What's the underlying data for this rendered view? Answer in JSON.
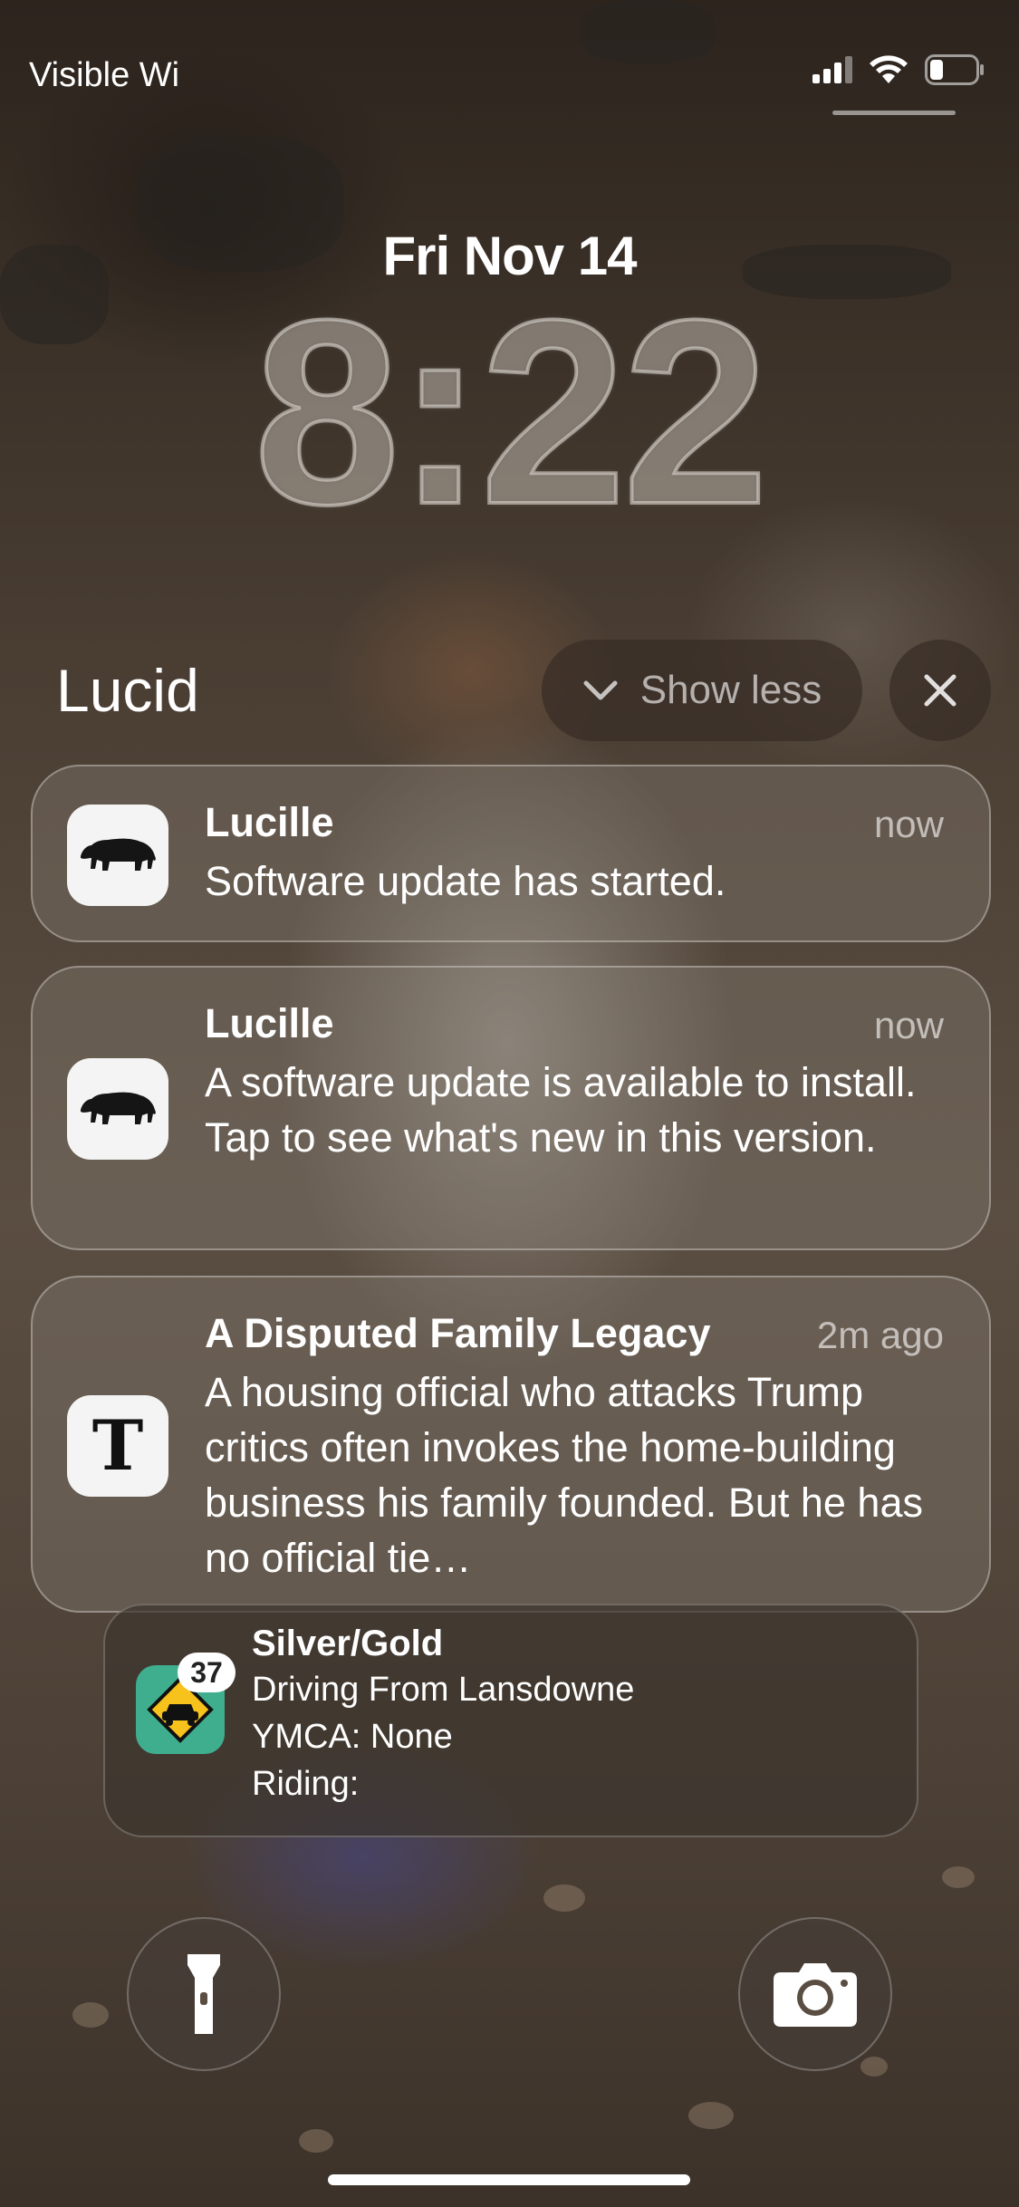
{
  "status_bar": {
    "carrier": "Visible Wi"
  },
  "lock": {
    "date": "Fri Nov 14",
    "time": "8:22"
  },
  "group": {
    "title": "Lucid",
    "show_less_label": "Show less"
  },
  "notifications": [
    {
      "app_icon": "bear-icon",
      "title": "Lucille",
      "time": "now",
      "body": "Software update has started."
    },
    {
      "app_icon": "bear-icon",
      "title": "Lucille",
      "time": "now",
      "body": "A software update is available to install. Tap to see what's new in this version."
    },
    {
      "app_icon": "nyt-logo-icon",
      "title": "A Disputed Family Legacy",
      "time": "2m ago",
      "body": "A housing official who attacks Trump critics often invokes the home-building business his family founded. But he has no official tie…"
    }
  ],
  "stack": {
    "app_icon": "car-road-sign-icon",
    "badge": "37",
    "title": "Silver/Gold",
    "lines": [
      "Driving From Lansdowne",
      "YMCA: None",
      "Riding:"
    ]
  },
  "colors": {
    "stack_icon_bg": "#3fae8e",
    "card_bg": "rgba(135,125,115,0.38)"
  }
}
